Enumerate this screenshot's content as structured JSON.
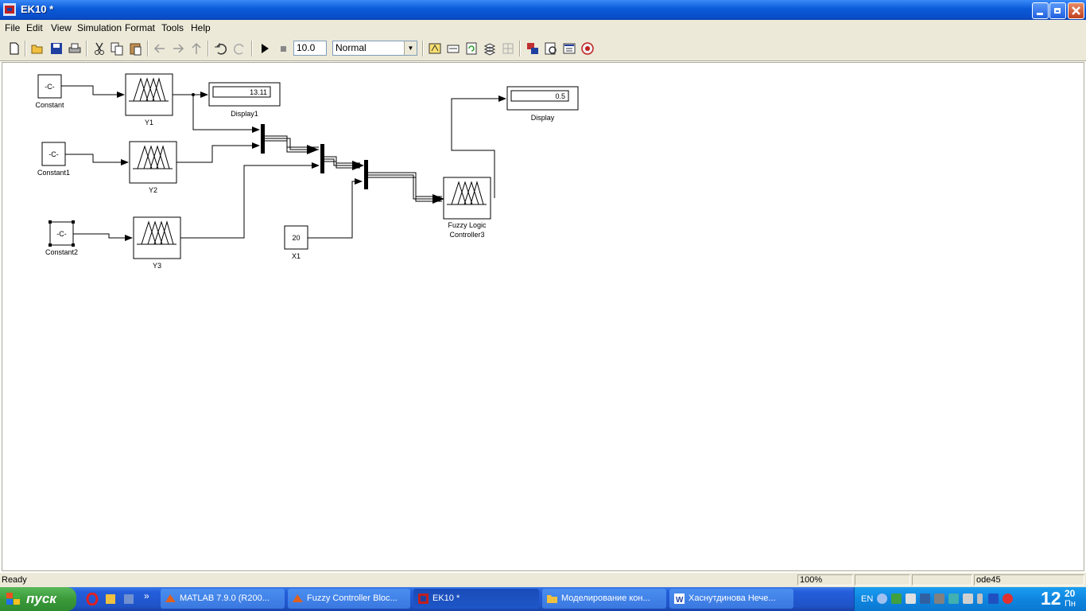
{
  "window": {
    "title": "EK10 *"
  },
  "menu": [
    "File",
    "Edit",
    "View",
    "Simulation",
    "Format",
    "Tools",
    "Help"
  ],
  "toolbar": {
    "stop_time": "10.0",
    "sim_mode": "Normal"
  },
  "model": {
    "constant_value": "-C-",
    "constant_label": "Constant",
    "constant1_label": "Constant1",
    "constant2_label": "Constant2",
    "y1_label": "Y1",
    "y2_label": "Y2",
    "y3_label": "Y3",
    "display1_value": "13.11",
    "display1_label": "Display1",
    "display_value": "0.5",
    "display_label": "Display",
    "x1_value": "20",
    "x1_label": "X1",
    "flc_label_line1": "Fuzzy Logic",
    "flc_label_line2": "Controller3"
  },
  "status": {
    "text": "Ready",
    "zoom": "100%",
    "solver": "ode45"
  },
  "taskbar": {
    "start_label": "пуск",
    "tasks": [
      "MATLAB  7.9.0 (R200...",
      "Fuzzy Controller Bloc...",
      "EK10 *",
      "Моделирование кон...",
      "Хаснутдинова Нече..."
    ],
    "language": "EN",
    "clock_hour": "12",
    "clock_min": "20",
    "clock_day": "Пн"
  },
  "colors": {
    "titlebar": "#0a5ad8",
    "taskbar": "#245edb",
    "start": "#3c9a3a",
    "chrome": "#ece9d8"
  }
}
